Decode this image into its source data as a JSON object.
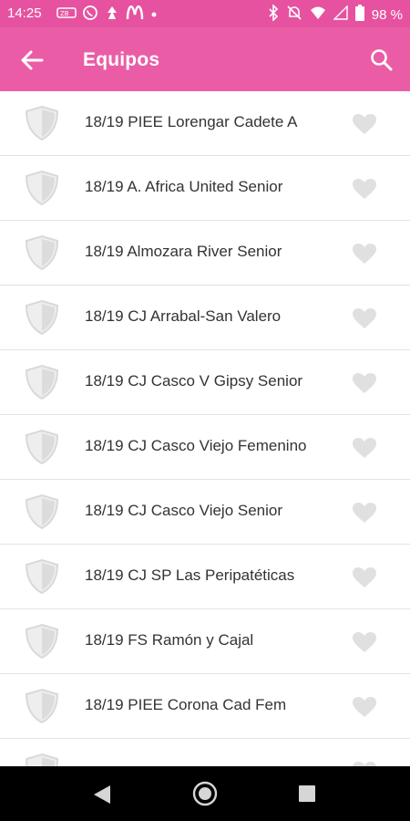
{
  "status_bar": {
    "time": "14:25",
    "battery": "98 %"
  },
  "toolbar": {
    "title": "Equipos"
  },
  "teams": [
    "18/19  PIEE Lorengar Cadete A",
    "18/19 A. Africa United Senior",
    "18/19 Almozara River Senior",
    "18/19 CJ Arrabal-San Valero",
    "18/19 CJ Casco V Gipsy Senior",
    "18/19 CJ Casco Viejo Femenino",
    "18/19 CJ Casco Viejo Senior",
    "18/19 CJ SP Las Peripatéticas",
    "18/19 FS Ramón y Cajal",
    "18/19 PIEE Corona Cad Fem",
    ""
  ],
  "colors": {
    "accent": "#ea5da6",
    "status_bar": "#e6529f",
    "icon_grey": "#e0e0e0",
    "text": "#333333"
  },
  "icons": {
    "row_leading": "shield-icon",
    "row_trailing": "heart-icon"
  }
}
